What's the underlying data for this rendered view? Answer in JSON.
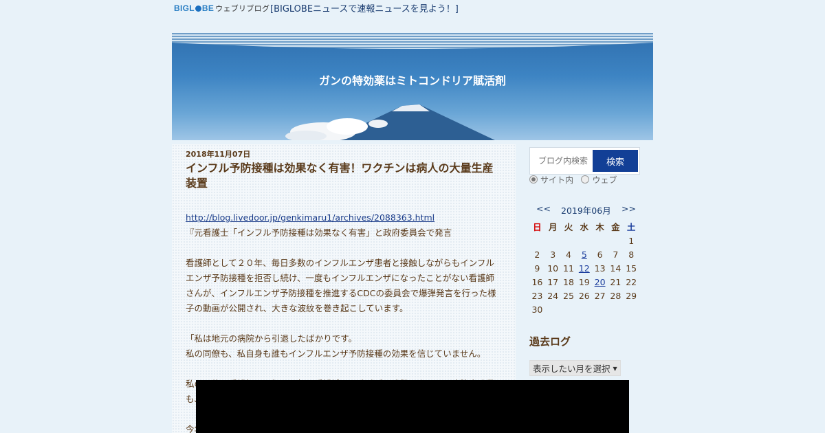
{
  "topbar": {
    "logo_big_1": "BIGL",
    "logo_big_2": "BE",
    "logo_sub": "ウェブリブログ",
    "news_link": "[BIGLOBEニュースで速報ニュースを見よう！]"
  },
  "header": {
    "blog_title": "ガンの特効薬はミトコンドリア賦活剤"
  },
  "post": {
    "date": "2018年11月07日",
    "title": "インフル予防接種は効果なく有害！ワクチンは病人の大量生産装置",
    "link": "http://blog.livedoor.jp/genkimaru1/archives/2088363.html",
    "line1": "『元看護士「インフル予防接種は効果なく有害」と政府委員会で発言",
    "para1": "看護師として２０年、毎日多数のインフルエンザ患者と接触しながらもインフルエンザ予防接種を拒否し続け、一度もインフルエンザになったことがない看護師さんが、インフルエンザ予防接種を推進するCDCの委員会で爆弾発言を行った様子の動画が公開され、大きな波紋を巻き起こしています。",
    "para2a": "「私は地元の病院から引退したばかりです。",
    "para2b": "私の同僚も、私自身も誰もインフルエンザ予防接種の効果を信じていません。",
    "para3": "私の同僚の看護師、医師、医師の看護補、医療助手、病院スタッフ、病院事務員も、",
    "para4": "今年"
  },
  "search": {
    "placeholder": "ブログ内検索",
    "button": "検索",
    "opt_site": "サイト内",
    "opt_web": "ウェブ"
  },
  "calendar": {
    "prev": "<<",
    "month": "2019年06月",
    "next": ">>",
    "weekdays": [
      "日",
      "月",
      "火",
      "水",
      "木",
      "金",
      "土"
    ],
    "rows": [
      [
        "",
        "",
        "",
        "",
        "",
        "",
        "1"
      ],
      [
        "2",
        "3",
        "4",
        "5",
        "6",
        "7",
        "8"
      ],
      [
        "9",
        "10",
        "11",
        "12",
        "13",
        "14",
        "15"
      ],
      [
        "16",
        "17",
        "18",
        "19",
        "20",
        "21",
        "22"
      ],
      [
        "23",
        "24",
        "25",
        "26",
        "27",
        "28",
        "29"
      ],
      [
        "30",
        "",
        "",
        "",
        "",
        "",
        ""
      ]
    ],
    "linked_days": [
      "5",
      "12",
      "20"
    ]
  },
  "archive": {
    "title": "過去ログ",
    "select_label": "表示したい月を選択",
    "arrow": "▼"
  },
  "colors": {
    "header_blue": "#3d84c3",
    "button_navy": "#123f96",
    "text_brown": "#5a3a1a",
    "sunday_red": "#d40000"
  }
}
